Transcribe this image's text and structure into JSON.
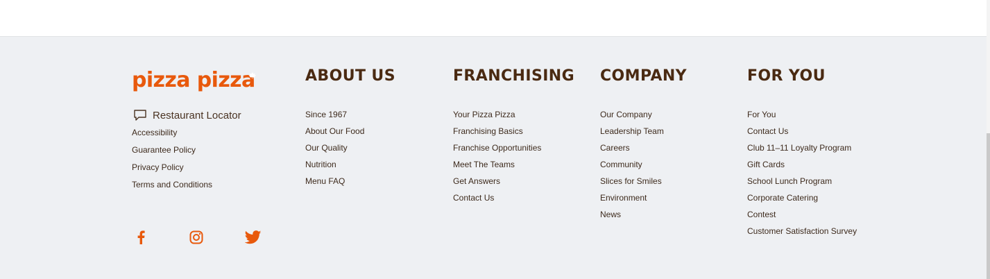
{
  "colors": {
    "brand": "#e8590c",
    "heading": "#4a2a12",
    "text": "#3d2a1c",
    "footer_bg": "#eef0f3"
  },
  "brand": {
    "logo_text": "pizza pizza",
    "locator_icon": "chat-bubble-icon",
    "locator_label": "Restaurant Locator",
    "links": [
      "Accessibility",
      "Guarantee Policy",
      "Privacy Policy",
      "Terms and Conditions"
    ],
    "social": [
      "facebook-icon",
      "instagram-icon",
      "twitter-icon"
    ]
  },
  "columns": {
    "about": {
      "title": "ABOUT US",
      "links": [
        "Since 1967",
        "About Our Food",
        "Our Quality",
        "Nutrition",
        "Menu FAQ"
      ]
    },
    "franchising": {
      "title": "FRANCHISING",
      "links": [
        "Your Pizza Pizza",
        "Franchising Basics",
        "Franchise Opportunities",
        "Meet The Teams",
        "Get Answers",
        "Contact Us"
      ]
    },
    "company": {
      "title": "COMPANY",
      "links": [
        "Our Company",
        "Leadership Team",
        "Careers",
        "Community",
        "Slices for Smiles",
        "Environment",
        "News"
      ]
    },
    "foryou": {
      "title": "FOR YOU",
      "links": [
        "For You",
        "Contact Us",
        "Club 11–11 Loyalty Program",
        "Gift Cards",
        "School Lunch Program",
        "Corporate Catering",
        "Contest",
        "Customer Satisfaction Survey"
      ]
    }
  }
}
